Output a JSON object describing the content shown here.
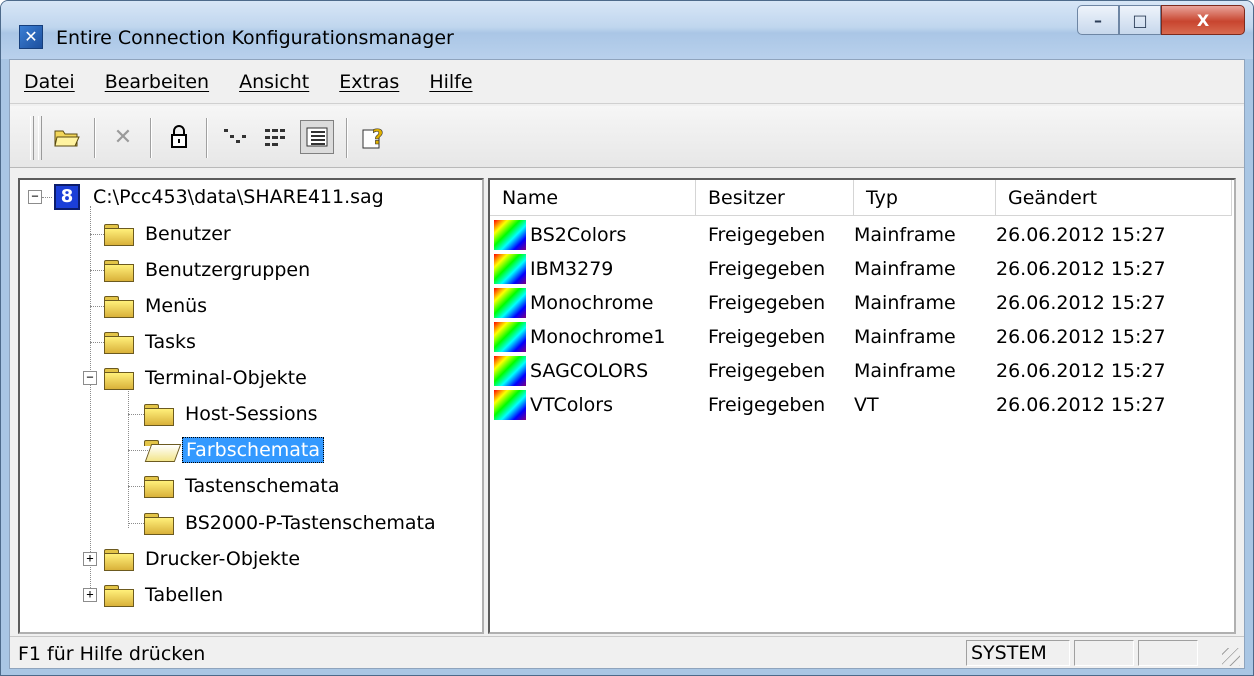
{
  "window": {
    "title": "Entire Connection Konfigurationsmanager",
    "minimize": "–",
    "maximize": "□",
    "close": "X"
  },
  "menu": [
    {
      "label": "Datei"
    },
    {
      "label": "Bearbeiten"
    },
    {
      "label": "Ansicht"
    },
    {
      "label": "Extras"
    },
    {
      "label": "Hilfe"
    }
  ],
  "toolbar": {
    "icons": [
      "open-folder-icon",
      "delete-icon",
      "lock-icon",
      "large-icons-view-icon",
      "list-view-icon",
      "details-view-icon",
      "help-icon"
    ]
  },
  "tree": {
    "root": "C:\\Pcc453\\data\\SHARE411.sag",
    "items": [
      {
        "label": "Benutzer"
      },
      {
        "label": "Benutzergruppen"
      },
      {
        "label": "Menüs"
      },
      {
        "label": "Tasks"
      },
      {
        "label": "Terminal-Objekte"
      },
      {
        "label": "Host-Sessions"
      },
      {
        "label": "Farbschemata"
      },
      {
        "label": "Tastenschemata"
      },
      {
        "label": "BS2000-P-Tastenschemata"
      },
      {
        "label": "Drucker-Objekte"
      },
      {
        "label": "Tabellen"
      }
    ]
  },
  "list": {
    "columns": [
      "Name",
      "Besitzer",
      "Typ",
      "Geändert"
    ],
    "rows": [
      {
        "name": "BS2Colors",
        "owner": "Freigegeben",
        "type": "Mainframe",
        "changed": "26.06.2012 15:27"
      },
      {
        "name": "IBM3279",
        "owner": "Freigegeben",
        "type": "Mainframe",
        "changed": "26.06.2012 15:27"
      },
      {
        "name": "Monochrome",
        "owner": "Freigegeben",
        "type": "Mainframe",
        "changed": "26.06.2012 15:27"
      },
      {
        "name": "Monochrome1",
        "owner": "Freigegeben",
        "type": "Mainframe",
        "changed": "26.06.2012 15:27"
      },
      {
        "name": "SAGCOLORS",
        "owner": "Freigegeben",
        "type": "Mainframe",
        "changed": "26.06.2012 15:27"
      },
      {
        "name": "VTColors",
        "owner": "Freigegeben",
        "type": "VT",
        "changed": "26.06.2012 15:27"
      }
    ]
  },
  "status": {
    "help_text": "F1 für Hilfe drücken",
    "user": "SYSTEM"
  },
  "colors": {
    "selection": "#3399ff",
    "titlebar": "#c0d6ee"
  }
}
